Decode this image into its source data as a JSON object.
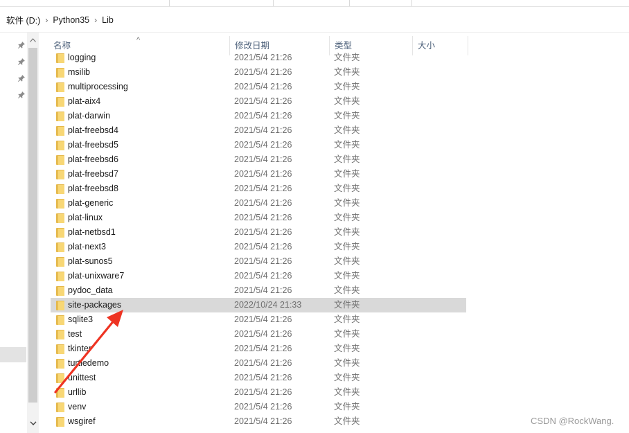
{
  "ribbon": {
    "groups": [
      "",
      "",
      "",
      ""
    ]
  },
  "breadcrumb": {
    "items": [
      "软件 (D:)",
      "Python35",
      "Lib"
    ],
    "separator": "›"
  },
  "icons": {
    "pin": "pin-icon",
    "folder": "folder-icon",
    "scroll_up": "chevron-up-icon",
    "scroll_down": "chevron-down-icon",
    "sort": "sort-up-icon"
  },
  "columns": {
    "name": "名称",
    "date": "修改日期",
    "type": "类型",
    "size": "大小",
    "sort_glyph": "^"
  },
  "files": [
    {
      "name": "logging",
      "date": "2021/5/4 21:26",
      "type": "文件夹"
    },
    {
      "name": "msilib",
      "date": "2021/5/4 21:26",
      "type": "文件夹"
    },
    {
      "name": "multiprocessing",
      "date": "2021/5/4 21:26",
      "type": "文件夹"
    },
    {
      "name": "plat-aix4",
      "date": "2021/5/4 21:26",
      "type": "文件夹"
    },
    {
      "name": "plat-darwin",
      "date": "2021/5/4 21:26",
      "type": "文件夹"
    },
    {
      "name": "plat-freebsd4",
      "date": "2021/5/4 21:26",
      "type": "文件夹"
    },
    {
      "name": "plat-freebsd5",
      "date": "2021/5/4 21:26",
      "type": "文件夹"
    },
    {
      "name": "plat-freebsd6",
      "date": "2021/5/4 21:26",
      "type": "文件夹"
    },
    {
      "name": "plat-freebsd7",
      "date": "2021/5/4 21:26",
      "type": "文件夹"
    },
    {
      "name": "plat-freebsd8",
      "date": "2021/5/4 21:26",
      "type": "文件夹"
    },
    {
      "name": "plat-generic",
      "date": "2021/5/4 21:26",
      "type": "文件夹"
    },
    {
      "name": "plat-linux",
      "date": "2021/5/4 21:26",
      "type": "文件夹"
    },
    {
      "name": "plat-netbsd1",
      "date": "2021/5/4 21:26",
      "type": "文件夹"
    },
    {
      "name": "plat-next3",
      "date": "2021/5/4 21:26",
      "type": "文件夹"
    },
    {
      "name": "plat-sunos5",
      "date": "2021/5/4 21:26",
      "type": "文件夹"
    },
    {
      "name": "plat-unixware7",
      "date": "2021/5/4 21:26",
      "type": "文件夹"
    },
    {
      "name": "pydoc_data",
      "date": "2021/5/4 21:26",
      "type": "文件夹"
    },
    {
      "name": "site-packages",
      "date": "2022/10/24 21:33",
      "type": "文件夹",
      "selected": true
    },
    {
      "name": "sqlite3",
      "date": "2021/5/4 21:26",
      "type": "文件夹"
    },
    {
      "name": "test",
      "date": "2021/5/4 21:26",
      "type": "文件夹"
    },
    {
      "name": "tkinter",
      "date": "2021/5/4 21:26",
      "type": "文件夹"
    },
    {
      "name": "turtledemo",
      "date": "2021/5/4 21:26",
      "type": "文件夹"
    },
    {
      "name": "unittest",
      "date": "2021/5/4 21:26",
      "type": "文件夹"
    },
    {
      "name": "urllib",
      "date": "2021/5/4 21:26",
      "type": "文件夹"
    },
    {
      "name": "venv",
      "date": "2021/5/4 21:26",
      "type": "文件夹"
    },
    {
      "name": "wsgiref",
      "date": "2021/5/4 21:26",
      "type": "文件夹"
    }
  ],
  "annotation": {
    "color": "#ee3322"
  },
  "watermark": "CSDN @RockWang."
}
